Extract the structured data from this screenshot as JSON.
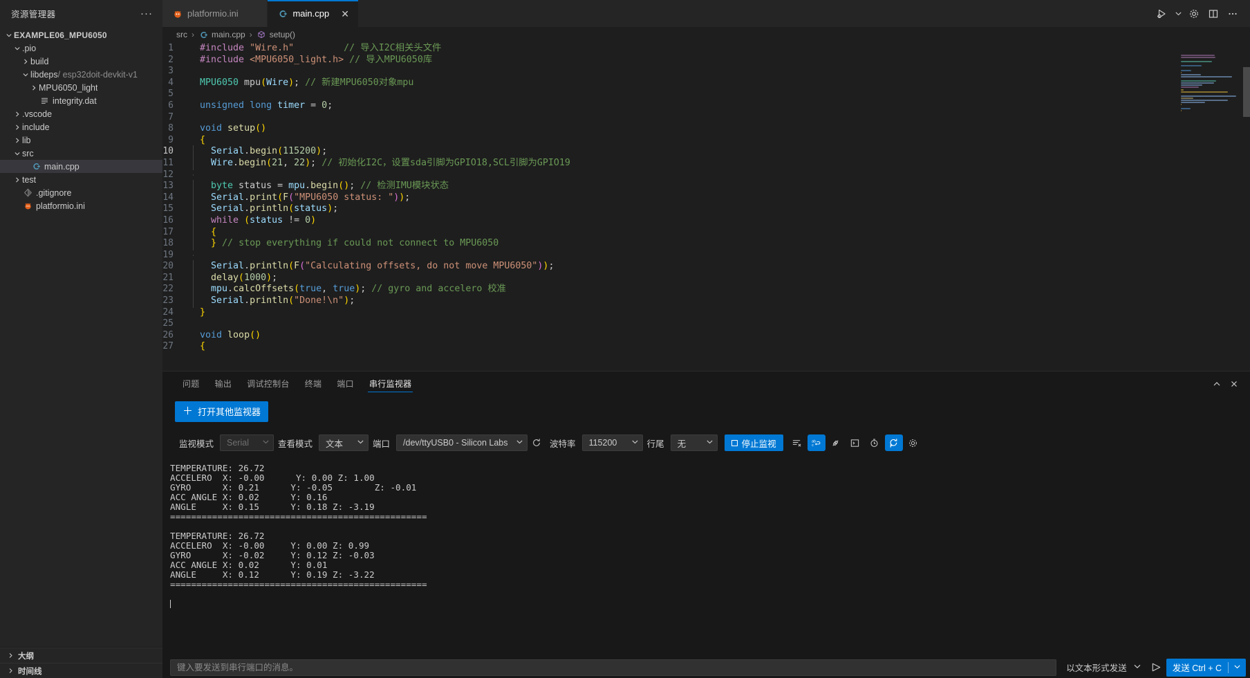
{
  "sidebar": {
    "title": "资源管理器",
    "more_label": "···",
    "tree": [
      {
        "label": "EXAMPLE06_MPU6050",
        "indent": 0,
        "chevron": "down",
        "icon": "",
        "root": true
      },
      {
        "label": ".pio",
        "indent": 1,
        "chevron": "down",
        "icon": "folder-icon"
      },
      {
        "label": "build",
        "indent": 2,
        "chevron": "right",
        "icon": "folder-icon"
      },
      {
        "label": "libdeps",
        "suffix": "/ esp32doit-devkit-v1",
        "indent": 2,
        "chevron": "down",
        "icon": "folder-icon"
      },
      {
        "label": "MPU6050_light",
        "indent": 3,
        "chevron": "right",
        "icon": "folder-icon"
      },
      {
        "label": "integrity.dat",
        "indent": 3,
        "chevron": "none",
        "icon": "file-lines-icon"
      },
      {
        "label": ".vscode",
        "indent": 1,
        "chevron": "right",
        "icon": "folder-icon"
      },
      {
        "label": "include",
        "indent": 1,
        "chevron": "right",
        "icon": "folder-icon"
      },
      {
        "label": "lib",
        "indent": 1,
        "chevron": "right",
        "icon": "folder-icon"
      },
      {
        "label": "src",
        "indent": 1,
        "chevron": "down",
        "icon": "folder-icon"
      },
      {
        "label": "main.cpp",
        "indent": 2,
        "chevron": "none",
        "icon": "cpp-file-icon",
        "selected": true
      },
      {
        "label": "test",
        "indent": 1,
        "chevron": "right",
        "icon": "folder-icon"
      },
      {
        "label": ".gitignore",
        "indent": 1,
        "chevron": "none",
        "icon": "git-icon"
      },
      {
        "label": "platformio.ini",
        "indent": 1,
        "chevron": "none",
        "icon": "platformio-icon"
      }
    ],
    "sections": [
      {
        "label": "大纲"
      },
      {
        "label": "时间线"
      }
    ]
  },
  "tabs": [
    {
      "label": "platformio.ini",
      "icon": "platformio-icon",
      "active": false
    },
    {
      "label": "main.cpp",
      "icon": "cpp-file-icon",
      "active": true,
      "close": "✕"
    }
  ],
  "editor_actions": [
    {
      "name": "run-and-debug-icon"
    },
    {
      "name": "chevron-down-icon"
    },
    {
      "name": "gear-icon"
    },
    {
      "name": "split-editor-icon"
    },
    {
      "name": "more-actions-icon"
    }
  ],
  "breadcrumb": {
    "items": [
      "src",
      "main.cpp",
      "setup()"
    ]
  },
  "code": {
    "lines": [
      {
        "n": 1,
        "tokens": [
          {
            "t": "#include ",
            "c": "mac"
          },
          {
            "t": "\"Wire.h\"",
            "c": "str"
          },
          {
            "t": "         ",
            "c": "pun"
          },
          {
            "t": "// 导入I2C相关头文件",
            "c": "cmt"
          }
        ]
      },
      {
        "n": 2,
        "tokens": [
          {
            "t": "#include ",
            "c": "mac"
          },
          {
            "t": "<MPU6050_light.h>",
            "c": "str"
          },
          {
            "t": " ",
            "c": "pun"
          },
          {
            "t": "// 导入MPU6050库",
            "c": "cmt"
          }
        ]
      },
      {
        "n": 3,
        "tokens": []
      },
      {
        "n": 4,
        "tokens": [
          {
            "t": "MPU6050",
            "c": "typ"
          },
          {
            "t": " mpu",
            "c": "pun"
          },
          {
            "t": "(",
            "c": "br1"
          },
          {
            "t": "Wire",
            "c": "var"
          },
          {
            "t": ")",
            "c": "br1"
          },
          {
            "t": "; ",
            "c": "pun"
          },
          {
            "t": "// 新建MPU6050对象mpu",
            "c": "cmt"
          }
        ]
      },
      {
        "n": 5,
        "tokens": []
      },
      {
        "n": 6,
        "tokens": [
          {
            "t": "unsigned",
            "c": "kw"
          },
          {
            "t": " ",
            "c": "pun"
          },
          {
            "t": "long",
            "c": "kw"
          },
          {
            "t": " ",
            "c": "pun"
          },
          {
            "t": "timer",
            "c": "var"
          },
          {
            "t": " = ",
            "c": "pun"
          },
          {
            "t": "0",
            "c": "num"
          },
          {
            "t": ";",
            "c": "pun"
          }
        ]
      },
      {
        "n": 7,
        "tokens": []
      },
      {
        "n": 8,
        "tokens": [
          {
            "t": "void",
            "c": "kw"
          },
          {
            "t": " ",
            "c": "pun"
          },
          {
            "t": "setup",
            "c": "fn"
          },
          {
            "t": "()",
            "c": "br1"
          }
        ]
      },
      {
        "n": 9,
        "tokens": [
          {
            "t": "{",
            "c": "br1"
          }
        ]
      },
      {
        "n": 10,
        "tokens": [
          {
            "t": "  ",
            "c": "pun"
          },
          {
            "t": "Serial",
            "c": "var"
          },
          {
            "t": ".",
            "c": "pun"
          },
          {
            "t": "begin",
            "c": "fn"
          },
          {
            "t": "(",
            "c": "br1"
          },
          {
            "t": "115200",
            "c": "num"
          },
          {
            "t": ")",
            "c": "br1"
          },
          {
            "t": ";",
            "c": "pun"
          }
        ],
        "current": true,
        "guide": true
      },
      {
        "n": 11,
        "tokens": [
          {
            "t": "  ",
            "c": "pun"
          },
          {
            "t": "Wire",
            "c": "var"
          },
          {
            "t": ".",
            "c": "pun"
          },
          {
            "t": "begin",
            "c": "fn"
          },
          {
            "t": "(",
            "c": "br1"
          },
          {
            "t": "21",
            "c": "num"
          },
          {
            "t": ", ",
            "c": "pun"
          },
          {
            "t": "22",
            "c": "num"
          },
          {
            "t": ")",
            "c": "br1"
          },
          {
            "t": "; ",
            "c": "pun"
          },
          {
            "t": "// 初始化I2C，设置sda引脚为GPIO18,SCL引脚为GPIO19",
            "c": "cmt"
          }
        ],
        "guide": true
      },
      {
        "n": 12,
        "tokens": [],
        "guide": true
      },
      {
        "n": 13,
        "tokens": [
          {
            "t": "  ",
            "c": "pun"
          },
          {
            "t": "byte",
            "c": "typ"
          },
          {
            "t": " status ",
            "c": "pun"
          },
          {
            "t": "= ",
            "c": "pun"
          },
          {
            "t": "mpu",
            "c": "var"
          },
          {
            "t": ".",
            "c": "pun"
          },
          {
            "t": "begin",
            "c": "fn"
          },
          {
            "t": "()",
            "c": "br1"
          },
          {
            "t": "; ",
            "c": "pun"
          },
          {
            "t": "// 检测IMU模块状态",
            "c": "cmt"
          }
        ],
        "guide": true
      },
      {
        "n": 14,
        "tokens": [
          {
            "t": "  ",
            "c": "pun"
          },
          {
            "t": "Serial",
            "c": "var"
          },
          {
            "t": ".",
            "c": "pun"
          },
          {
            "t": "print",
            "c": "fn"
          },
          {
            "t": "(",
            "c": "br1"
          },
          {
            "t": "F",
            "c": "fn"
          },
          {
            "t": "(",
            "c": "br2"
          },
          {
            "t": "\"MPU6050 status: \"",
            "c": "str"
          },
          {
            "t": ")",
            "c": "br2"
          },
          {
            "t": ")",
            "c": "br1"
          },
          {
            "t": ";",
            "c": "pun"
          }
        ],
        "guide": true
      },
      {
        "n": 15,
        "tokens": [
          {
            "t": "  ",
            "c": "pun"
          },
          {
            "t": "Serial",
            "c": "var"
          },
          {
            "t": ".",
            "c": "pun"
          },
          {
            "t": "println",
            "c": "fn"
          },
          {
            "t": "(",
            "c": "br1"
          },
          {
            "t": "status",
            "c": "var"
          },
          {
            "t": ")",
            "c": "br1"
          },
          {
            "t": ";",
            "c": "pun"
          }
        ],
        "guide": true
      },
      {
        "n": 16,
        "tokens": [
          {
            "t": "  ",
            "c": "pun"
          },
          {
            "t": "while",
            "c": "kw2"
          },
          {
            "t": " ",
            "c": "pun"
          },
          {
            "t": "(",
            "c": "br1"
          },
          {
            "t": "status",
            "c": "var"
          },
          {
            "t": " != ",
            "c": "pun"
          },
          {
            "t": "0",
            "c": "num"
          },
          {
            "t": ")",
            "c": "br1"
          }
        ],
        "guide": true
      },
      {
        "n": 17,
        "tokens": [
          {
            "t": "  ",
            "c": "pun"
          },
          {
            "t": "{",
            "c": "br1"
          }
        ],
        "guide": true
      },
      {
        "n": 18,
        "tokens": [
          {
            "t": "  ",
            "c": "pun"
          },
          {
            "t": "}",
            "c": "br1"
          },
          {
            "t": " ",
            "c": "pun"
          },
          {
            "t": "// stop everything if could not connect to MPU6050",
            "c": "cmt"
          }
        ],
        "guide": true
      },
      {
        "n": 19,
        "tokens": [],
        "guide": true
      },
      {
        "n": 20,
        "tokens": [
          {
            "t": "  ",
            "c": "pun"
          },
          {
            "t": "Serial",
            "c": "var"
          },
          {
            "t": ".",
            "c": "pun"
          },
          {
            "t": "println",
            "c": "fn"
          },
          {
            "t": "(",
            "c": "br1"
          },
          {
            "t": "F",
            "c": "fn"
          },
          {
            "t": "(",
            "c": "br2"
          },
          {
            "t": "\"Calculating offsets, do not move MPU6050\"",
            "c": "str"
          },
          {
            "t": ")",
            "c": "br2"
          },
          {
            "t": ")",
            "c": "br1"
          },
          {
            "t": ";",
            "c": "pun"
          }
        ],
        "guide": true
      },
      {
        "n": 21,
        "tokens": [
          {
            "t": "  ",
            "c": "pun"
          },
          {
            "t": "delay",
            "c": "fn"
          },
          {
            "t": "(",
            "c": "br1"
          },
          {
            "t": "1000",
            "c": "num"
          },
          {
            "t": ")",
            "c": "br1"
          },
          {
            "t": ";",
            "c": "pun"
          }
        ],
        "guide": true
      },
      {
        "n": 22,
        "tokens": [
          {
            "t": "  ",
            "c": "pun"
          },
          {
            "t": "mpu",
            "c": "var"
          },
          {
            "t": ".",
            "c": "pun"
          },
          {
            "t": "calcOffsets",
            "c": "fn"
          },
          {
            "t": "(",
            "c": "br1"
          },
          {
            "t": "true",
            "c": "kw"
          },
          {
            "t": ", ",
            "c": "pun"
          },
          {
            "t": "true",
            "c": "kw"
          },
          {
            "t": ")",
            "c": "br1"
          },
          {
            "t": "; ",
            "c": "pun"
          },
          {
            "t": "// gyro and accelero 校准",
            "c": "cmt"
          }
        ],
        "guide": true
      },
      {
        "n": 23,
        "tokens": [
          {
            "t": "  ",
            "c": "pun"
          },
          {
            "t": "Serial",
            "c": "var"
          },
          {
            "t": ".",
            "c": "pun"
          },
          {
            "t": "println",
            "c": "fn"
          },
          {
            "t": "(",
            "c": "br1"
          },
          {
            "t": "\"Done!\\n\"",
            "c": "str"
          },
          {
            "t": ")",
            "c": "br1"
          },
          {
            "t": ";",
            "c": "pun"
          }
        ],
        "guide": true
      },
      {
        "n": 24,
        "tokens": [
          {
            "t": "}",
            "c": "br1"
          }
        ]
      },
      {
        "n": 25,
        "tokens": []
      },
      {
        "n": 26,
        "tokens": [
          {
            "t": "void",
            "c": "kw"
          },
          {
            "t": " ",
            "c": "pun"
          },
          {
            "t": "loop",
            "c": "fn"
          },
          {
            "t": "()",
            "c": "br1"
          }
        ]
      },
      {
        "n": 27,
        "tokens": [
          {
            "t": "{",
            "c": "br1"
          }
        ]
      }
    ]
  },
  "panel": {
    "tabs": [
      {
        "label": "问题",
        "active": false
      },
      {
        "label": "输出",
        "active": false
      },
      {
        "label": "调试控制台",
        "active": false
      },
      {
        "label": "终端",
        "active": false
      },
      {
        "label": "端口",
        "active": false
      },
      {
        "label": "串行监视器",
        "active": true
      }
    ],
    "actions": [
      {
        "name": "chevron-up-icon"
      },
      {
        "name": "close-icon"
      }
    ],
    "open_other_monitor_label": "打开其他监视器",
    "open_other_monitor_plus": "＋",
    "toolbar": {
      "monitor_mode_label": "监视模式",
      "monitor_mode_value": "Serial",
      "view_mode_label": "查看模式",
      "view_mode_value": "文本",
      "port_label": "端口",
      "port_value": "/dev/ttyUSB0 - Silicon Labs",
      "baud_label": "波特率",
      "baud_value": "115200",
      "lineend_label": "行尾",
      "lineend_value": "无",
      "stop_label": "停止监视",
      "icons": [
        {
          "name": "clear-output-icon",
          "active": false
        },
        {
          "name": "word-wrap-icon",
          "active": true
        },
        {
          "name": "plug-disconnect-icon",
          "active": false
        },
        {
          "name": "terminal-icon",
          "active": false
        },
        {
          "name": "timestamp-clock-icon",
          "active": false
        },
        {
          "name": "auto-reconnect-icon",
          "active": true
        },
        {
          "name": "gear-icon",
          "active": false
        }
      ]
    },
    "output": [
      "TEMPERATURE: 26.72",
      "ACCELERO  X: -0.00      Y: 0.00 Z: 1.00",
      "GYRO      X: 0.21      Y: -0.05        Z: -0.01",
      "ACC ANGLE X: 0.02      Y: 0.16",
      "ANGLE     X: 0.15      Y: 0.18 Z: -3.19",
      "=================================================",
      "",
      "TEMPERATURE: 26.72",
      "ACCELERO  X: -0.00     Y: 0.00 Z: 0.99",
      "GYRO      X: -0.02     Y: 0.12 Z: -0.03",
      "ACC ANGLE X: 0.02      Y: 0.01",
      "ANGLE     X: 0.12      Y: 0.19 Z: -3.22",
      "=================================================",
      ""
    ],
    "send": {
      "placeholder": "键入要发送到串行端口的消息。",
      "value": "",
      "send_as_label": "以文本形式发送",
      "send_button_label": "发送 Ctrl + C"
    }
  },
  "colors": {
    "accent": "#0078d4",
    "editor_bg": "#1e1e1e",
    "sidebar_bg": "#252526",
    "panel_bg": "#181818",
    "tab_active_bg": "#1e1e1e"
  }
}
